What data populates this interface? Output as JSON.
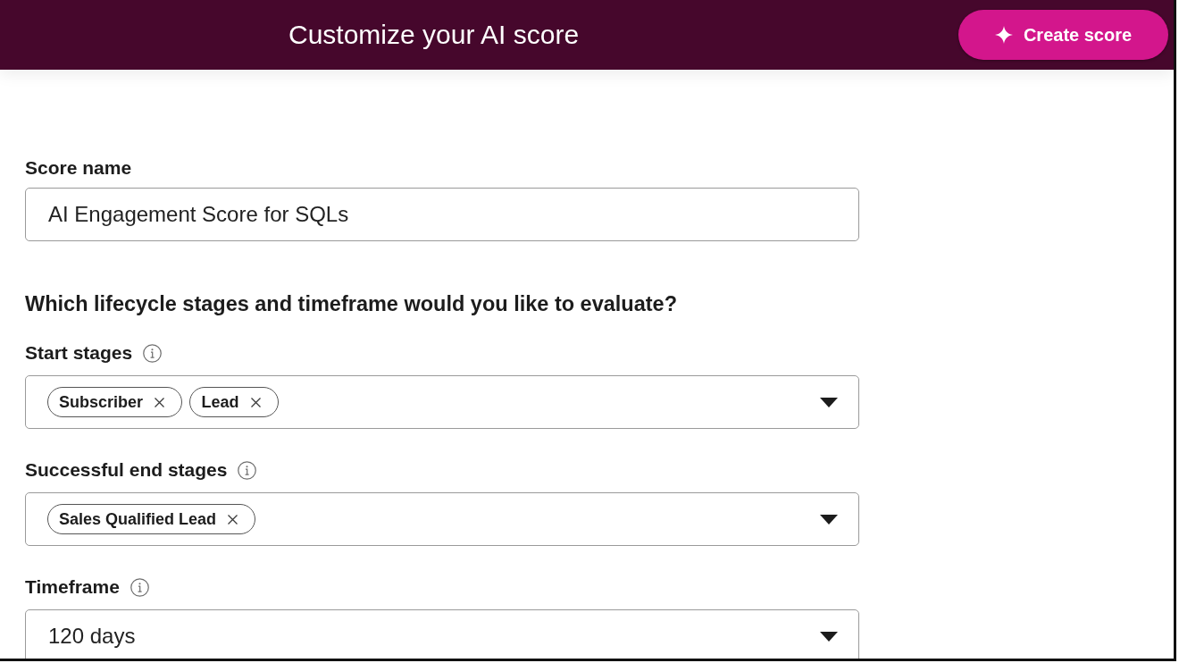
{
  "header": {
    "title": "Customize your AI score",
    "create_button": {
      "label": "Create score"
    }
  },
  "form": {
    "score_name": {
      "label": "Score name",
      "value": "AI Engagement Score for SQLs"
    },
    "section_heading": "Which lifecycle stages and timeframe would you like to evaluate?",
    "fields": [
      {
        "kind": "multiselect",
        "label": "Start stages",
        "chips": [
          "Subscriber",
          "Lead"
        ]
      },
      {
        "kind": "multiselect",
        "label": "Successful end stages",
        "chips": [
          "Sales Qualified Lead"
        ]
      },
      {
        "kind": "select",
        "label": "Timeframe",
        "value": "120 days"
      }
    ]
  }
}
